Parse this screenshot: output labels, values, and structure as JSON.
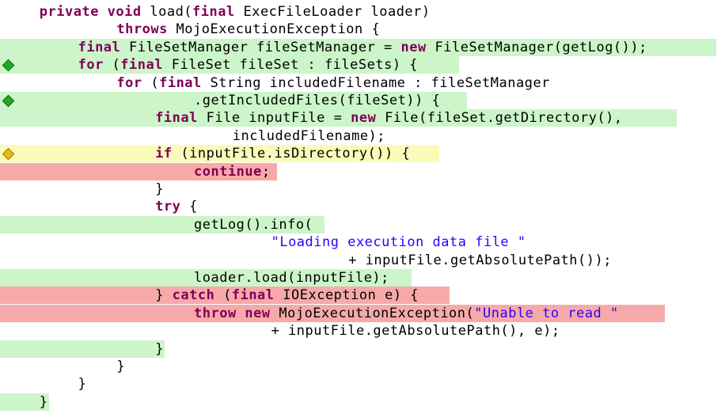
{
  "editor": {
    "lines": [
      {
        "indent": 4,
        "bg": "none",
        "bg_end": 0,
        "marker": "none",
        "tokens": [
          {
            "t": "private void",
            "k": "kw"
          },
          {
            "t": " load("
          },
          {
            "t": "final",
            "k": "kw"
          },
          {
            "t": " ExecFileLoader loader)"
          }
        ]
      },
      {
        "indent": 12,
        "bg": "none",
        "bg_end": 0,
        "marker": "none",
        "tokens": [
          {
            "t": "throws",
            "k": "kw"
          },
          {
            "t": " MojoExecutionException {"
          }
        ]
      },
      {
        "indent": 8,
        "bg": "green",
        "bg_end": 905,
        "marker": "none",
        "tokens": [
          {
            "t": "final",
            "k": "kw"
          },
          {
            "t": " FileSetManager fileSetManager = "
          },
          {
            "t": "new",
            "k": "kw"
          },
          {
            "t": " FileSetManager(getLog());"
          }
        ]
      },
      {
        "indent": 8,
        "bg": "green",
        "bg_end": 580,
        "marker": "green",
        "tokens": [
          {
            "t": "for",
            "k": "kw"
          },
          {
            "t": " ("
          },
          {
            "t": "final",
            "k": "kw"
          },
          {
            "t": " FileSet fileSet : fileSets) {"
          }
        ]
      },
      {
        "indent": 12,
        "bg": "none",
        "bg_end": 0,
        "marker": "none",
        "tokens": [
          {
            "t": "for",
            "k": "kw"
          },
          {
            "t": " ("
          },
          {
            "t": "final",
            "k": "kw"
          },
          {
            "t": " String includedFilename : fileSetManager"
          }
        ]
      },
      {
        "indent": 20,
        "bg": "green",
        "bg_end": 590,
        "marker": "green",
        "tokens": [
          {
            "t": ".getIncludedFiles(fileSet)) {"
          }
        ]
      },
      {
        "indent": 16,
        "bg": "green",
        "bg_end": 855,
        "marker": "none",
        "tokens": [
          {
            "t": "final",
            "k": "kw"
          },
          {
            "t": " File inputFile = "
          },
          {
            "t": "new",
            "k": "kw"
          },
          {
            "t": " File(fileSet.getDirectory(),"
          }
        ]
      },
      {
        "indent": 24,
        "bg": "none",
        "bg_end": 0,
        "marker": "none",
        "tokens": [
          {
            "t": "includedFilename);"
          }
        ]
      },
      {
        "indent": 16,
        "bg": "yellow",
        "bg_end": 555,
        "marker": "yellow",
        "tokens": [
          {
            "t": "if",
            "k": "kw"
          },
          {
            "t": " (inputFile.isDirectory()) {"
          }
        ]
      },
      {
        "indent": 20,
        "bg": "red",
        "bg_end": 350,
        "marker": "none",
        "tokens": [
          {
            "t": "continue",
            "k": "kw"
          },
          {
            "t": ";"
          }
        ]
      },
      {
        "indent": 16,
        "bg": "none",
        "bg_end": 0,
        "marker": "none",
        "tokens": [
          {
            "t": "}"
          }
        ]
      },
      {
        "indent": 16,
        "bg": "none",
        "bg_end": 0,
        "marker": "none",
        "tokens": [
          {
            "t": "try",
            "k": "kw"
          },
          {
            "t": " {"
          }
        ]
      },
      {
        "indent": 20,
        "bg": "green",
        "bg_end": 410,
        "marker": "none",
        "tokens": [
          {
            "t": "getLog().info("
          }
        ]
      },
      {
        "indent": 28,
        "bg": "none",
        "bg_end": 0,
        "marker": "none",
        "tokens": [
          {
            "t": "\"Loading execution data file \"",
            "k": "str"
          }
        ]
      },
      {
        "indent": 36,
        "bg": "none",
        "bg_end": 0,
        "marker": "none",
        "tokens": [
          {
            "t": "+ inputFile.getAbsolutePath());"
          }
        ]
      },
      {
        "indent": 20,
        "bg": "green",
        "bg_end": 520,
        "marker": "none",
        "tokens": [
          {
            "t": "loader.load(inputFile);"
          }
        ]
      },
      {
        "indent": 16,
        "bg": "red",
        "bg_end": 568,
        "marker": "none",
        "tokens": [
          {
            "t": "} "
          },
          {
            "t": "catch",
            "k": "kw"
          },
          {
            "t": " ("
          },
          {
            "t": "final",
            "k": "kw"
          },
          {
            "t": " IOException e) {"
          }
        ]
      },
      {
        "indent": 20,
        "bg": "red",
        "bg_end": 840,
        "marker": "none",
        "tokens": [
          {
            "t": "throw new",
            "k": "kw"
          },
          {
            "t": " MojoExecutionException("
          },
          {
            "t": "\"Unable to read \"",
            "k": "str"
          }
        ]
      },
      {
        "indent": 28,
        "bg": "none",
        "bg_end": 0,
        "marker": "none",
        "tokens": [
          {
            "t": "+ inputFile.getAbsolutePath(), e);"
          }
        ]
      },
      {
        "indent": 16,
        "bg": "green",
        "bg_end": 208,
        "marker": "none",
        "tokens": [
          {
            "t": "}"
          }
        ]
      },
      {
        "indent": 12,
        "bg": "none",
        "bg_end": 0,
        "marker": "none",
        "tokens": [
          {
            "t": "}"
          }
        ]
      },
      {
        "indent": 8,
        "bg": "none",
        "bg_end": 0,
        "marker": "none",
        "tokens": [
          {
            "t": "}"
          }
        ]
      },
      {
        "indent": 4,
        "bg": "green",
        "bg_end": 62,
        "marker": "none",
        "tokens": [
          {
            "t": "}"
          }
        ]
      }
    ]
  }
}
